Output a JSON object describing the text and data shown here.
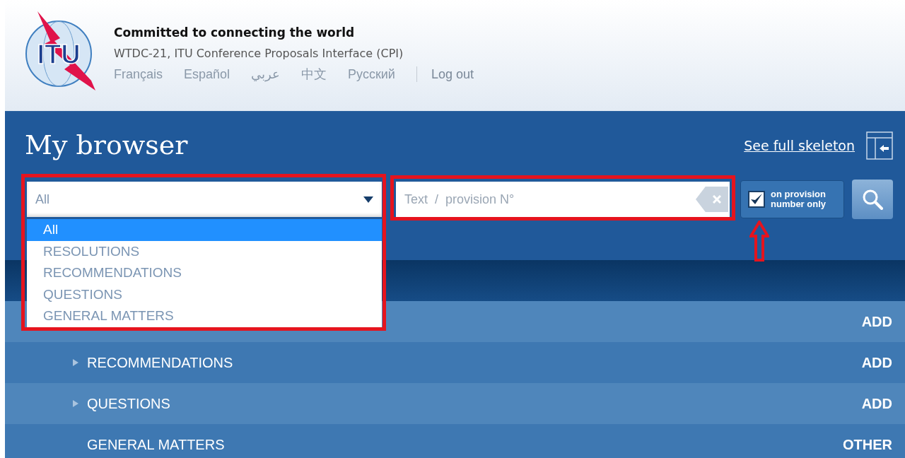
{
  "header": {
    "logo_text": "ITU",
    "tagline": "Committed to connecting the world",
    "subtitle": "WTDC-21, ITU Conference Proposals Interface (CPI)",
    "languages": [
      "Français",
      "Español",
      "عربي",
      "中文",
      "Русский"
    ],
    "logout": "Log out"
  },
  "page_title": "My browser",
  "skeleton_link": "See full skeleton",
  "filter": {
    "value": "All",
    "options": [
      {
        "label": "All",
        "selected": true
      },
      {
        "label": "RESOLUTIONS",
        "selected": false
      },
      {
        "label": "RECOMMENDATIONS",
        "selected": false
      },
      {
        "label": "QUESTIONS",
        "selected": false
      },
      {
        "label": "GENERAL MATTERS",
        "selected": false
      }
    ]
  },
  "search": {
    "placeholder": "Text  /  provision N°"
  },
  "provision_only": {
    "label": "on provision number only",
    "checked": true
  },
  "rows": [
    {
      "action": "ADD"
    },
    {
      "label": "RECOMMENDATIONS",
      "expandable": true,
      "action": "ADD"
    },
    {
      "label": "QUESTIONS",
      "expandable": true,
      "action": "ADD"
    },
    {
      "label": "GENERAL MATTERS",
      "expandable": false,
      "action": "OTHER"
    }
  ],
  "annotations": [
    {
      "kind": "frame"
    },
    {
      "kind": "frame"
    },
    {
      "kind": "arrow"
    }
  ]
}
